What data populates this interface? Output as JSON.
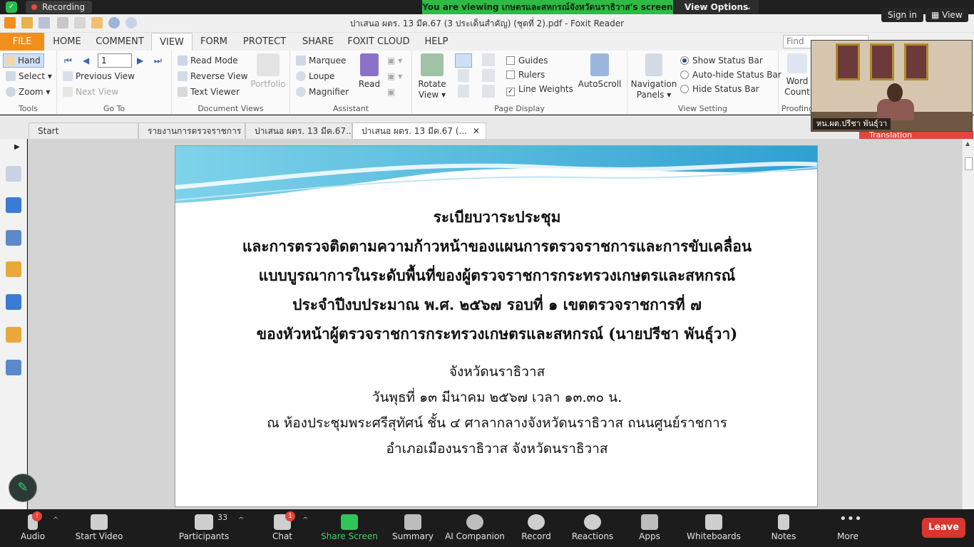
{
  "zoom": {
    "recording_label": "Recording",
    "share_banner": "You are viewing เกษตรและสหกรณ์จังหวัดนราธิวาส's screen",
    "view_options_label": "View Options",
    "sign_in_label": "Sign in",
    "view_label": "View",
    "toolbar": {
      "audio": "Audio",
      "start_video": "Start Video",
      "participants": "Participants",
      "participants_count": "33",
      "chat": "Chat",
      "chat_badge": "1",
      "audio_badge": "!",
      "share_screen": "Share Screen",
      "summary": "Summary",
      "ai_companion": "AI Companion",
      "record": "Record",
      "reactions": "Reactions",
      "apps": "Apps",
      "whiteboards": "Whiteboards",
      "notes": "Notes",
      "more": "More",
      "leave": "Leave"
    }
  },
  "foxit": {
    "window_title": "ปาเสนอ ผตร. 13 มีค.67 (3 ประเด็นสำคัญ) (ชุดที่ 2).pdf - Foxit Reader",
    "tabs": [
      "FILE",
      "HOME",
      "COMMENT",
      "VIEW",
      "FORM",
      "PROTECT",
      "SHARE",
      "FOXIT CLOUD",
      "HELP"
    ],
    "find_placeholder": "Find",
    "ribbon": {
      "tools": {
        "hand": "Hand",
        "select": "Select",
        "zoom": "Zoom",
        "group": "Tools"
      },
      "goto": {
        "page_value": "1",
        "previous_view": "Previous View",
        "next_view": "Next View",
        "group": "Go To"
      },
      "document_views": {
        "read_mode": "Read Mode",
        "reverse_view": "Reverse View",
        "text_viewer": "Text Viewer",
        "portfolio": "Portfolio",
        "group": "Document Views"
      },
      "assistant": {
        "marquee": "Marquee",
        "loupe": "Loupe",
        "magnifier": "Magnifier",
        "read": "Read",
        "group": "Assistant"
      },
      "page_display": {
        "rotate_view": "Rotate",
        "rotate_view_2": "View",
        "guides": "Guides",
        "rulers": "Rulers",
        "line_weights": "Line Weights",
        "autoscroll": "AutoScroll",
        "group": "Page Display"
      },
      "view_setting": {
        "navigation_panels": "Navigation",
        "navigation_panels_2": "Panels",
        "show_status_bar": "Show Status Bar",
        "auto_hide_status_bar": "Auto-hide Status Bar",
        "hide_status_bar": "Hide Status Bar",
        "group": "View Setting"
      },
      "proofing": {
        "word": "Word",
        "count": "Count",
        "group": "Proofing"
      }
    },
    "doc_tabs": [
      {
        "label": "Start"
      },
      {
        "label": "รายงานการตรวจราชการ ..."
      },
      {
        "label": "ปาเสนอ ผตร. 13 มีค.67..."
      },
      {
        "label": "ปาเสนอ ผตร. 13 มีค.67 (..."
      }
    ],
    "translation_label": "Translation"
  },
  "video": {
    "participant_name": "หน.ผต.ปรีชา  พันธุ์วา"
  },
  "document": {
    "heading_lines": [
      "ระเบียบวาระประชุม",
      "และการตรวจติดตามความก้าวหน้าของแผนการตรวจราชการและการขับเคลื่อน",
      "แบบบูรณาการในระดับพื้นที่ของผู้ตรวจราชการกระทรวงเกษตรและสหกรณ์",
      "ประจำปีงบประมาณ พ.ศ. ๒๕๖๗ รอบที่ ๑ เขตตรวจราชการที่ ๗",
      "ของหัวหน้าผู้ตรวจราชการกระทรวงเกษตรและสหกรณ์ (นายปรีชา พันธุ์วา)"
    ],
    "detail_lines": [
      "จังหวัดนราธิวาส",
      "วันพุธที่ ๑๓ มีนาคม ๒๕๖๗ เวลา ๑๓.๓๐ น.",
      "ณ ห้องประชุมพระศรีสุทัศน์ ชั้น ๔ ศาลากลางจังหวัดนราธิวาส ถนนศูนย์ราชการ",
      "อำเภอเมืองนราธิวาส จังหวัดนราธิวาส"
    ]
  }
}
